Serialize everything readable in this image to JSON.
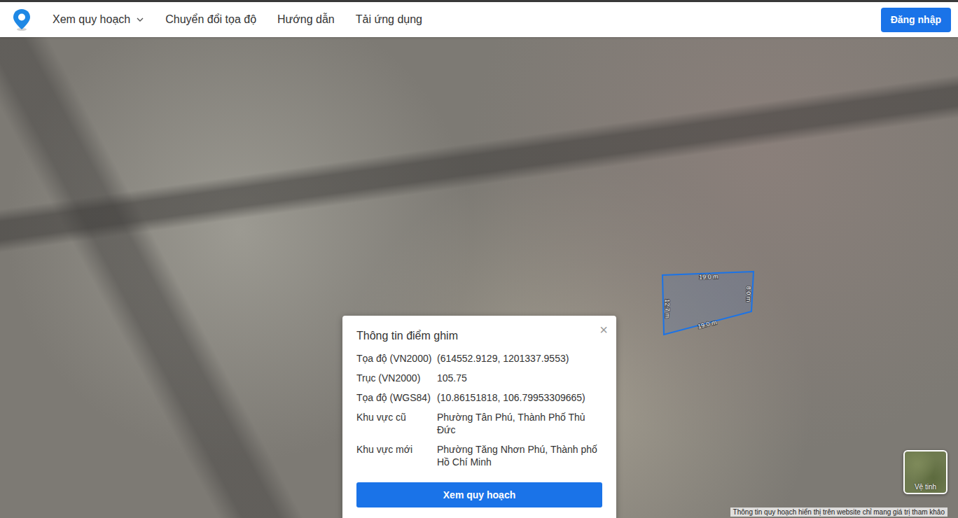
{
  "nav": {
    "items": [
      {
        "label": "Xem quy hoạch",
        "dropdown": true
      },
      {
        "label": "Chuyển đổi tọa độ",
        "dropdown": false
      },
      {
        "label": "Hướng dẫn",
        "dropdown": false
      },
      {
        "label": "Tải ứng dụng",
        "dropdown": false
      }
    ],
    "login": "Đăng nhập"
  },
  "map": {
    "parcel": {
      "edges": [
        "19.0 m",
        "8.0 m",
        "19.0 m",
        "12.7 m"
      ]
    },
    "layer_toggle": {
      "label": "Vệ tinh"
    },
    "attribution": "Thông tin quy hoạch hiển thị trên website chỉ mang giá trị tham khảo"
  },
  "popup": {
    "title": "Thông tin điểm ghim",
    "close": "×",
    "rows": [
      {
        "label": "Tọa độ (VN2000)",
        "value": "(614552.9129, 1201337.9553)"
      },
      {
        "label": "Trục (VN2000)",
        "value": "105.75"
      },
      {
        "label": "Tọa độ (WGS84)",
        "value": "(10.86151818, 106.79953309665)"
      },
      {
        "label": "Khu vực cũ",
        "value": "Phường Tân Phú, Thành Phố Thủ Đức"
      },
      {
        "label": "Khu vực mới",
        "value": "Phường Tăng Nhơn Phú, Thành phố Hồ Chí Minh"
      }
    ],
    "button": "Xem quy hoạch"
  }
}
